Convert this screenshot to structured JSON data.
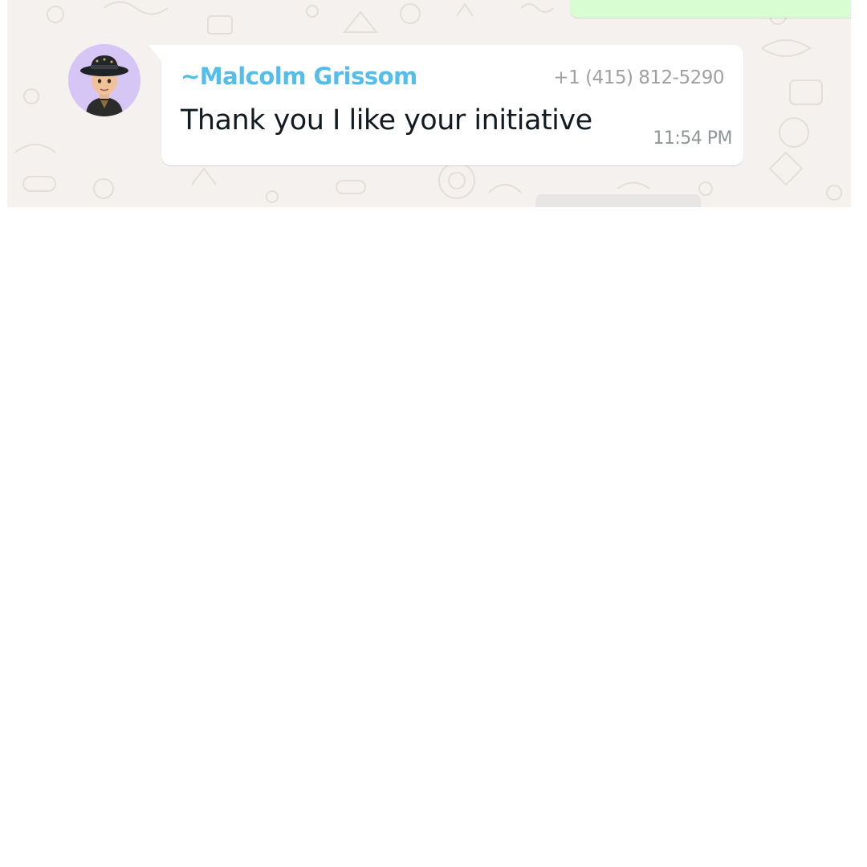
{
  "message": {
    "sender_name": "~Malcolm Grissom",
    "sender_phone": "+1 (415) 812-5290",
    "text": "Thank you I like your initiative",
    "time": "11:54 PM"
  },
  "colors": {
    "chat_background": "#f4f1ee",
    "outgoing_bubble": "#d9fdd3",
    "incoming_bubble": "#ffffff",
    "sender_name": "#53bdeb",
    "avatar_background": "#d5c6f5"
  },
  "icons": {
    "avatar": "avatar-3d-character-icon"
  }
}
